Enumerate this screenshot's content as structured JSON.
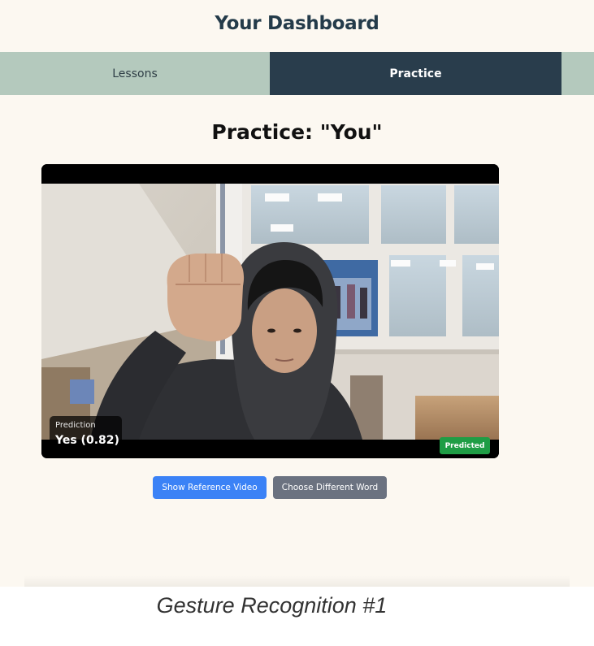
{
  "header": {
    "title": "Your Dashboard"
  },
  "tabs": [
    {
      "label": "Lessons",
      "active": false
    },
    {
      "label": "Practice",
      "active": true
    }
  ],
  "practice": {
    "heading": "Practice: \"You\"",
    "prediction_label": "Prediction",
    "prediction_value": "Yes (0.82)",
    "status_badge": "Predicted",
    "buttons": {
      "show_reference": "Show Reference Video",
      "choose_word": "Choose Different Word"
    }
  },
  "caption": "Gesture Recognition #1",
  "colors": {
    "background": "#fcf8f1",
    "tab_bar": "#b4c9bd",
    "tab_active": "#293d4c",
    "badge_green": "#1f9d45",
    "button_blue": "#3b82f6",
    "button_gray": "#6b7280"
  }
}
